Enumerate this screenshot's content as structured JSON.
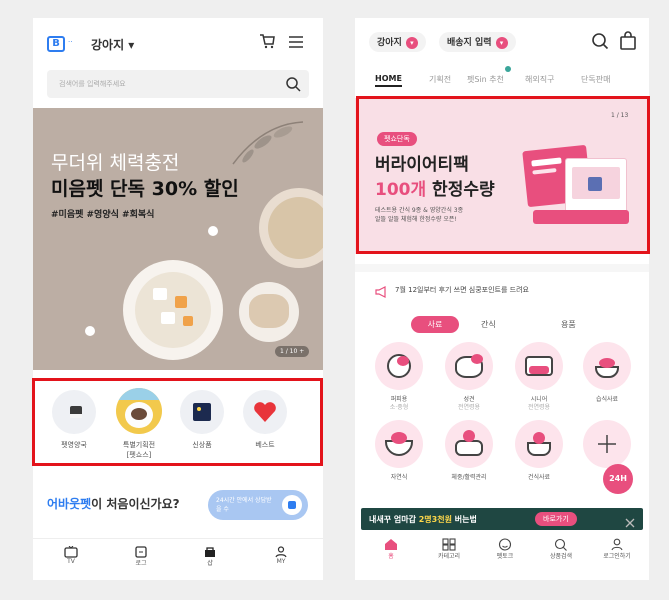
{
  "left": {
    "header": {
      "brand": "B",
      "location": "강아지 ▾"
    },
    "search": {
      "placeholder": "검색어를 입력해주세요"
    },
    "banner": {
      "line1": "무더위 체력충전",
      "line2": "미음펫 단독 30% 할인",
      "tags": "#미음펫 #영양식 #회복식",
      "counter": "1 / 10 +"
    },
    "categories": [
      {
        "label": "펫영양국",
        "sub": ""
      },
      {
        "label": "특별기획전",
        "sub": "[펫쇼스]"
      },
      {
        "label": "신상품",
        "sub": ""
      },
      {
        "label": "베스트",
        "sub": ""
      }
    ],
    "promo": {
      "text_brand": "어바웃펫",
      "text_rest": "이 처음이신가요?",
      "badge": "24시간 안에서 상담받을 수"
    },
    "bottom_nav": [
      "TV",
      "로그",
      "샵",
      "MY"
    ]
  },
  "right": {
    "chips": {
      "pet": "강아지",
      "delivery": "배송지 입력"
    },
    "tabs": [
      "HOME",
      "기획전",
      "펫Sin 추천",
      "해외직구",
      "단독판매"
    ],
    "banner": {
      "badge": "펫쇼단독",
      "line1": "버라이어티팩",
      "line2_highlight": "100개",
      "line2_rest": " 한정수량",
      "desc1": "테스트용 간식 9종 & 영양간식 3종",
      "desc2": "알뜰 알뜰 체험해 한정수량 오픈!",
      "counter": "1 / 13"
    },
    "notice": "7월 12일부터 후기 쓰면 심쿵포인트를 드려요",
    "category_tabs": [
      "사료",
      "간식",
      "용품"
    ],
    "products": [
      {
        "label": "퍼피용",
        "sub": "소·중형"
      },
      {
        "label": "성견",
        "sub": "전연령용"
      },
      {
        "label": "시니어",
        "sub": "전연령용"
      },
      {
        "label": "습식사료",
        "sub": ""
      },
      {
        "label": "자연식",
        "sub": ""
      },
      {
        "label": "체중/활력관리",
        "sub": ""
      },
      {
        "label": "건식사료",
        "sub": ""
      },
      {
        "label": "",
        "sub": ""
      }
    ],
    "fab": "24H",
    "toast": {
      "text_pre": "내새꾸 엄마갑 ",
      "text_highlight": "2명3천원",
      "text_post": " 버는법",
      "button": "바로가기"
    },
    "bottom_nav": [
      "홈",
      "카테고리",
      "펫토크",
      "상품검색",
      "로그인하기"
    ]
  },
  "colors": {
    "accent_blue": "#2e7df0",
    "accent_pink": "#e84f7e",
    "highlight_red": "#e3131b"
  }
}
